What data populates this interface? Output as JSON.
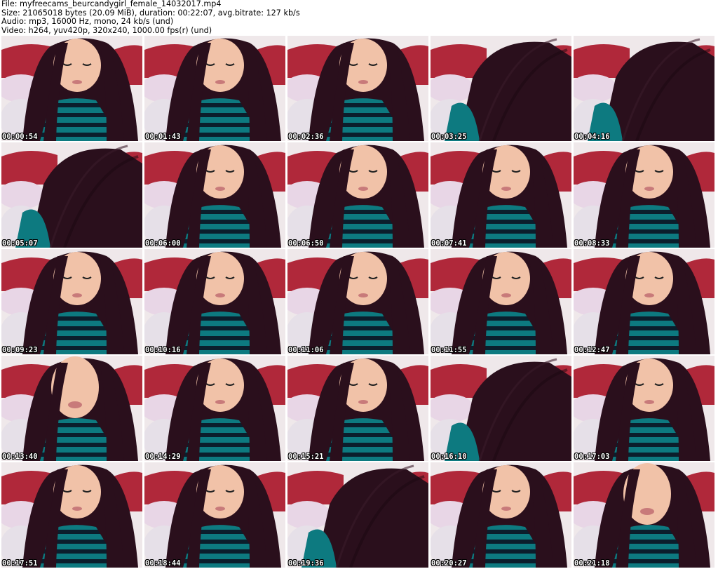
{
  "info": {
    "file": "File: myfreecams_beurcandygirl_female_14032017.mp4",
    "size": "Size: 21065018 bytes (20.09 MiB), duration: 00:22:07, avg.bitrate: 127 kb/s",
    "audio": "Audio: mp3, 16000 Hz, mono, 24 kb/s (und)",
    "video": "Video: h264, yuv420p, 320x240, 1000.00 fps(r) (und)"
  },
  "thumbnails": [
    {
      "timestamp": "00:00:54",
      "kind": "face-down"
    },
    {
      "timestamp": "00:01:43",
      "kind": "face-down"
    },
    {
      "timestamp": "00:02:36",
      "kind": "face-down"
    },
    {
      "timestamp": "00:03:25",
      "kind": "hair"
    },
    {
      "timestamp": "00:04:16",
      "kind": "hair"
    },
    {
      "timestamp": "00:05:07",
      "kind": "hair"
    },
    {
      "timestamp": "00:06:00",
      "kind": "face-down"
    },
    {
      "timestamp": "00:06:50",
      "kind": "face-down"
    },
    {
      "timestamp": "00:07:41",
      "kind": "face-down"
    },
    {
      "timestamp": "00:08:33",
      "kind": "face-down"
    },
    {
      "timestamp": "00:09:23",
      "kind": "face-down"
    },
    {
      "timestamp": "00:10:16",
      "kind": "face-down"
    },
    {
      "timestamp": "00:11:06",
      "kind": "face-down"
    },
    {
      "timestamp": "00:11:55",
      "kind": "face-down"
    },
    {
      "timestamp": "00:12:47",
      "kind": "face-down"
    },
    {
      "timestamp": "00:13:40",
      "kind": "face-up"
    },
    {
      "timestamp": "00:14:29",
      "kind": "face-down"
    },
    {
      "timestamp": "00:15:21",
      "kind": "face-down"
    },
    {
      "timestamp": "00:16:10",
      "kind": "hair"
    },
    {
      "timestamp": "00:17:03",
      "kind": "face-down"
    },
    {
      "timestamp": "00:17:51",
      "kind": "face-down"
    },
    {
      "timestamp": "00:18:44",
      "kind": "face-down"
    },
    {
      "timestamp": "00:19:36",
      "kind": "hair"
    },
    {
      "timestamp": "00:20:27",
      "kind": "face-down"
    },
    {
      "timestamp": "00:21:18",
      "kind": "face-up"
    }
  ],
  "colors": {
    "background": "#ffffff",
    "hair": "#2a0f1c",
    "sweater_teal": "#0d7a80",
    "sweater_dark": "#0b1e2c",
    "bed_red": "#b0283a",
    "pillow": "#e8d6e6",
    "skin": "#f1c2a8"
  }
}
